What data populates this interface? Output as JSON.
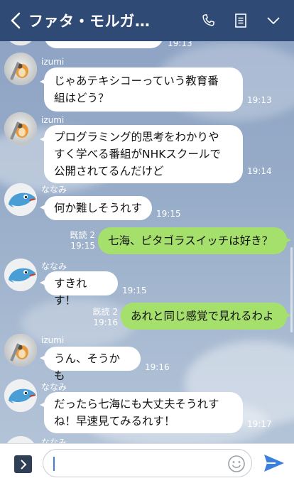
{
  "header": {
    "title": "ファタ・モルガ…"
  },
  "icons": {
    "back": "chevron-left-icon",
    "call": "phone-icon",
    "notes": "notes-icon",
    "menu": "chevron-down-icon",
    "more": "chevron-right-icon",
    "emoji": "emoji-icon",
    "send": "send-icon"
  },
  "colors": {
    "header": "#2f4a74",
    "my_bubble": "#a6e06c",
    "their_bubble": "#ffffff",
    "send": "#3b7fe0"
  },
  "messages": [
    {
      "time": "19:13"
    },
    {
      "sender": "izumi",
      "text1": "じゃあテキシコーっていう教育番",
      "text2": "組はどう？",
      "time": "19:13"
    },
    {
      "sender": "izumi",
      "text1": "プログラミング的思考をわかりや",
      "text2": "すく学べる番組がNHKスクールで",
      "text3": "公開されてるんだけど",
      "time": "19:14"
    },
    {
      "sender": "ななみ",
      "text1": "何か難しそうれす",
      "time": "19:15"
    },
    {
      "read": "既読 2",
      "time": "19:15",
      "text1": "七海、ピタゴラスイッチは好き？"
    },
    {
      "sender": "ななみ",
      "text1": "すきれす！",
      "time": "19:15"
    },
    {
      "read": "既読 2",
      "time": "19:16",
      "text1": "あれと同じ感覚で見れるわよ"
    },
    {
      "sender": "izumi",
      "text1": "うん、そうかも",
      "time": "19:16"
    },
    {
      "sender": "ななみ",
      "text1": "だったら七海にも大丈夫そうれす",
      "text2": "ね！早速見てみるれす！",
      "time": "19:17"
    },
    {
      "sender": "ななみ"
    }
  ],
  "footer": {
    "input_value": ""
  }
}
